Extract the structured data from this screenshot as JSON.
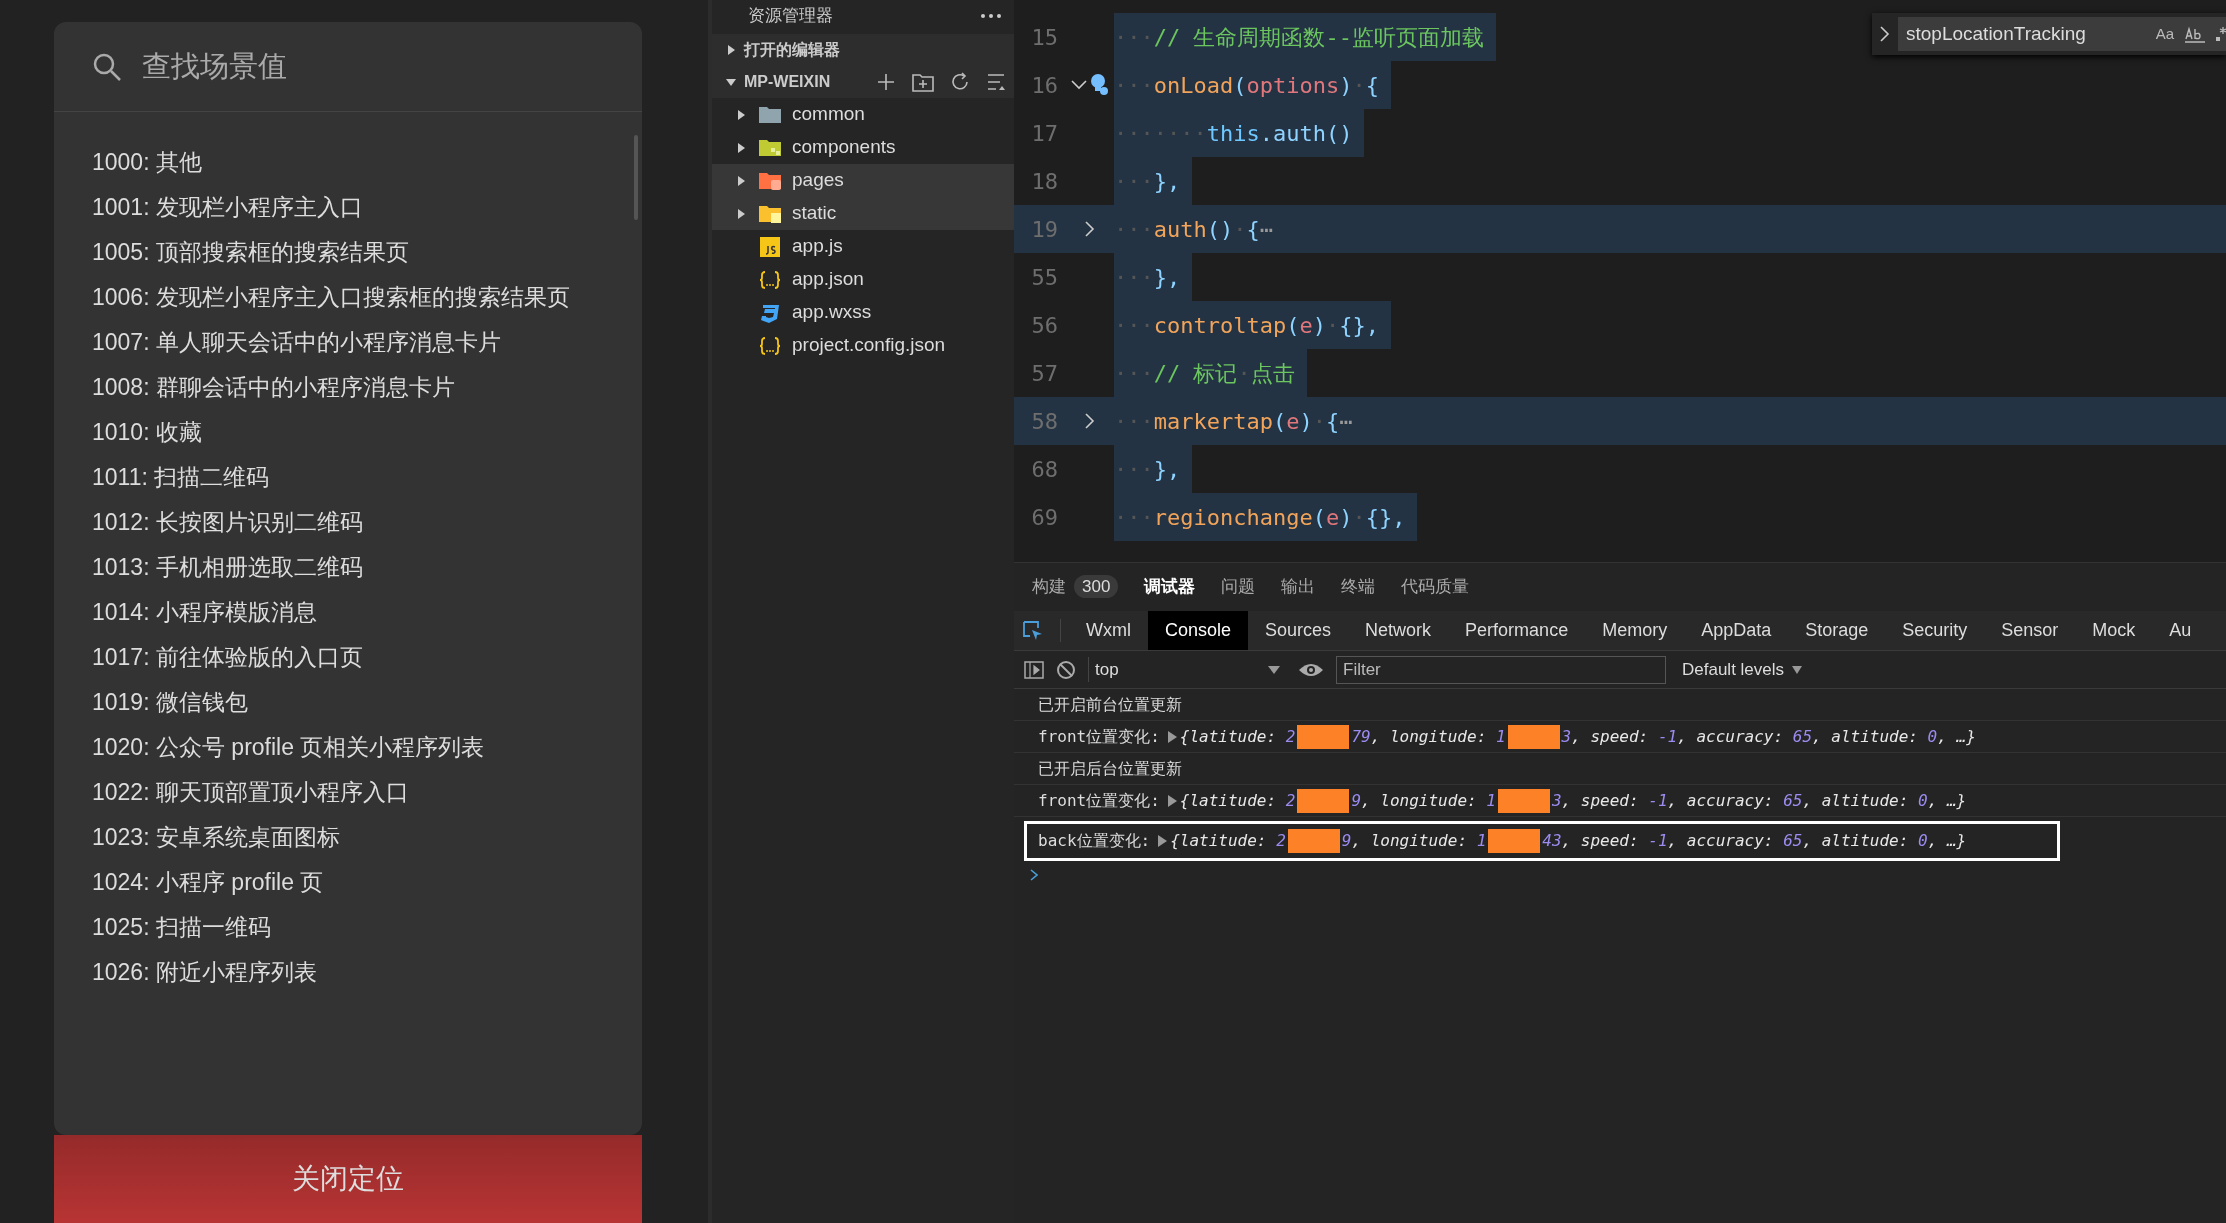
{
  "scene_panel": {
    "search": {
      "placeholder": "查找场景值"
    },
    "items": [
      "1000: 其他",
      "1001: 发现栏小程序主入口",
      "1005: 顶部搜索框的搜索结果页",
      "1006: 发现栏小程序主入口搜索框的搜索结果页",
      "1007: 单人聊天会话中的小程序消息卡片",
      "1008: 群聊会话中的小程序消息卡片",
      "1010: 收藏",
      "1011: 扫描二维码",
      "1012: 长按图片识别二维码",
      "1013: 手机相册选取二维码",
      "1014: 小程序模版消息",
      "1017: 前往体验版的入口页",
      "1019: 微信钱包",
      "1020: 公众号 profile 页相关小程序列表",
      "1022: 聊天顶部置顶小程序入口",
      "1023: 安卓系统桌面图标",
      "1024: 小程序 profile 页",
      "1025: 扫描一维码",
      "1026: 附近小程序列表"
    ],
    "button": "关闭定位"
  },
  "explorer": {
    "title": "资源管理器",
    "sections": [
      {
        "label": "打开的编辑器",
        "expanded": false
      },
      {
        "label": "MP-WEIXIN",
        "expanded": true
      }
    ],
    "tree": [
      {
        "label": "common",
        "kind": "folder",
        "selected": false
      },
      {
        "label": "components",
        "kind": "componentfolder",
        "selected": false
      },
      {
        "label": "pages",
        "kind": "pagefolder",
        "selected": true
      },
      {
        "label": "static",
        "kind": "assetfolder",
        "selected": true
      },
      {
        "label": "app.js",
        "kind": "script",
        "selected": false
      },
      {
        "label": "app.json",
        "kind": "json",
        "selected": false
      },
      {
        "label": "app.wxss",
        "kind": "stylesheet",
        "selected": false
      },
      {
        "label": "project.config.json",
        "kind": "json",
        "selected": false
      }
    ]
  },
  "editor": {
    "lines": [
      {
        "number": "15",
        "kind": "plain",
        "tokens": [
          {
            "kind": "ws",
            "text": "···"
          },
          {
            "kind": "comment",
            "text": "// 生命周期函数--监听页面加载"
          }
        ]
      },
      {
        "number": "16",
        "kind": "foldopen",
        "bulb": true,
        "tokens": [
          {
            "kind": "ws",
            "text": "···"
          },
          {
            "kind": "func",
            "text": "onLoad"
          },
          {
            "kind": "punct",
            "text": "("
          },
          {
            "kind": "param",
            "text": "options"
          },
          {
            "kind": "punct",
            "text": ")"
          },
          {
            "kind": "ws",
            "text": "·"
          },
          {
            "kind": "punct",
            "text": "{"
          }
        ]
      },
      {
        "number": "17",
        "kind": "plain",
        "tokens": [
          {
            "kind": "ws",
            "text": "·······"
          },
          {
            "kind": "keyword",
            "text": "this"
          },
          {
            "kind": "punct",
            "text": ".auth()"
          }
        ]
      },
      {
        "number": "18",
        "kind": "plain",
        "tokens": [
          {
            "kind": "ws",
            "text": "···"
          },
          {
            "kind": "punct",
            "text": "},"
          }
        ]
      },
      {
        "number": "19",
        "kind": "foldclosed",
        "tokens": [
          {
            "kind": "ws",
            "text": "···"
          },
          {
            "kind": "func",
            "text": "auth"
          },
          {
            "kind": "punct",
            "text": "()"
          },
          {
            "kind": "ws",
            "text": "·"
          },
          {
            "kind": "punct",
            "text": "{"
          },
          {
            "kind": "ellipsis",
            "text": "⋯"
          }
        ]
      },
      {
        "number": "55",
        "kind": "plain",
        "tokens": [
          {
            "kind": "ws",
            "text": "···"
          },
          {
            "kind": "punct",
            "text": "},"
          }
        ]
      },
      {
        "number": "56",
        "kind": "plain",
        "tokens": [
          {
            "kind": "ws",
            "text": "···"
          },
          {
            "kind": "func",
            "text": "controltap"
          },
          {
            "kind": "punct",
            "text": "("
          },
          {
            "kind": "param",
            "text": "e"
          },
          {
            "kind": "punct",
            "text": ")"
          },
          {
            "kind": "ws",
            "text": "·"
          },
          {
            "kind": "punct",
            "text": "{},"
          }
        ]
      },
      {
        "number": "57",
        "kind": "plain",
        "tokens": [
          {
            "kind": "ws",
            "text": "···"
          },
          {
            "kind": "comment",
            "text": "// 标记"
          },
          {
            "kind": "ws",
            "text": "·"
          },
          {
            "kind": "comment",
            "text": "点击"
          }
        ]
      },
      {
        "number": "58",
        "kind": "foldclosed",
        "tokens": [
          {
            "kind": "ws",
            "text": "···"
          },
          {
            "kind": "func",
            "text": "markertap"
          },
          {
            "kind": "punct",
            "text": "("
          },
          {
            "kind": "param",
            "text": "e"
          },
          {
            "kind": "punct",
            "text": ")"
          },
          {
            "kind": "ws",
            "text": "·"
          },
          {
            "kind": "punct",
            "text": "{"
          },
          {
            "kind": "ellipsis",
            "text": "⋯"
          }
        ]
      },
      {
        "number": "68",
        "kind": "plain",
        "tokens": [
          {
            "kind": "ws",
            "text": "···"
          },
          {
            "kind": "punct",
            "text": "},"
          }
        ]
      },
      {
        "number": "69",
        "kind": "plain",
        "tokens": [
          {
            "kind": "ws",
            "text": "···"
          },
          {
            "kind": "func",
            "text": "regionchange"
          },
          {
            "kind": "punct",
            "text": "("
          },
          {
            "kind": "param",
            "text": "e"
          },
          {
            "kind": "punct",
            "text": ")"
          },
          {
            "kind": "ws",
            "text": "·"
          },
          {
            "kind": "punct",
            "text": "{},"
          }
        ]
      }
    ],
    "find_widget": {
      "query": "stopLocationTracking",
      "case_option": "Aa"
    }
  },
  "devtools": {
    "panel_tabs": [
      {
        "label": "构建",
        "badge": "300",
        "selected": false
      },
      {
        "label": "调试器",
        "selected": true
      },
      {
        "label": "问题",
        "selected": false
      },
      {
        "label": "输出",
        "selected": false
      },
      {
        "label": "终端",
        "selected": false
      },
      {
        "label": "代码质量",
        "selected": false
      }
    ],
    "tool_tabs": [
      {
        "label": "Wxml",
        "selected": false
      },
      {
        "label": "Console",
        "selected": true
      },
      {
        "label": "Sources",
        "selected": false
      },
      {
        "label": "Network",
        "selected": false
      },
      {
        "label": "Performance",
        "selected": false
      },
      {
        "label": "Memory",
        "selected": false
      },
      {
        "label": "AppData",
        "selected": false
      },
      {
        "label": "Storage",
        "selected": false
      },
      {
        "label": "Security",
        "selected": false
      },
      {
        "label": "Sensor",
        "selected": false
      },
      {
        "label": "Mock",
        "selected": false
      },
      {
        "label": "Au",
        "selected": false
      }
    ],
    "console_toolbar": {
      "context": "top",
      "filter_placeholder": "Filter",
      "levels": "Default levels"
    },
    "messages": [
      {
        "kind": "text",
        "text": "已开启前台位置更新",
        "highlighted": false
      },
      {
        "kind": "object",
        "label": "front位置变化:",
        "highlighted": false,
        "parts": [
          {
            "kind": "key",
            "text": "{latitude: "
          },
          {
            "kind": "num",
            "text": "2"
          },
          {
            "kind": "redacted"
          },
          {
            "kind": "num",
            "text": "79"
          },
          {
            "kind": "key",
            "text": ", longitude: "
          },
          {
            "kind": "num",
            "text": "1"
          },
          {
            "kind": "redacted"
          },
          {
            "kind": "num",
            "text": "3"
          },
          {
            "kind": "key",
            "text": ", speed: "
          },
          {
            "kind": "num",
            "text": "-1"
          },
          {
            "kind": "key",
            "text": ", accuracy: "
          },
          {
            "kind": "num",
            "text": "65"
          },
          {
            "kind": "key",
            "text": ", altitude: "
          },
          {
            "kind": "num",
            "text": "0"
          },
          {
            "kind": "key",
            "text": ", …}"
          }
        ]
      },
      {
        "kind": "text",
        "text": "已开启后台位置更新",
        "highlighted": false
      },
      {
        "kind": "object",
        "label": "front位置变化:",
        "highlighted": false,
        "parts": [
          {
            "kind": "key",
            "text": "{latitude: "
          },
          {
            "kind": "num",
            "text": "2"
          },
          {
            "kind": "redacted"
          },
          {
            "kind": "num",
            "text": "9"
          },
          {
            "kind": "key",
            "text": ", longitude: "
          },
          {
            "kind": "num",
            "text": "1"
          },
          {
            "kind": "redacted"
          },
          {
            "kind": "num",
            "text": "3"
          },
          {
            "kind": "key",
            "text": ", speed: "
          },
          {
            "kind": "num",
            "text": "-1"
          },
          {
            "kind": "key",
            "text": ", accuracy: "
          },
          {
            "kind": "num",
            "text": "65"
          },
          {
            "kind": "key",
            "text": ", altitude: "
          },
          {
            "kind": "num",
            "text": "0"
          },
          {
            "kind": "key",
            "text": ", …}"
          }
        ]
      },
      {
        "kind": "object",
        "label": "back位置变化:",
        "highlighted": true,
        "parts": [
          {
            "kind": "key",
            "text": "{latitude: "
          },
          {
            "kind": "num",
            "text": "2"
          },
          {
            "kind": "redacted"
          },
          {
            "kind": "num",
            "text": "9"
          },
          {
            "kind": "key",
            "text": ", longitude: "
          },
          {
            "kind": "num",
            "text": "1"
          },
          {
            "kind": "redacted"
          },
          {
            "kind": "num",
            "text": "43"
          },
          {
            "kind": "key",
            "text": ", speed: "
          },
          {
            "kind": "num",
            "text": "-1"
          },
          {
            "kind": "key",
            "text": ", accuracy: "
          },
          {
            "kind": "num",
            "text": "65"
          },
          {
            "kind": "key",
            "text": ", altitude: "
          },
          {
            "kind": "num",
            "text": "0"
          },
          {
            "kind": "key",
            "text": ", …}"
          }
        ]
      }
    ]
  }
}
